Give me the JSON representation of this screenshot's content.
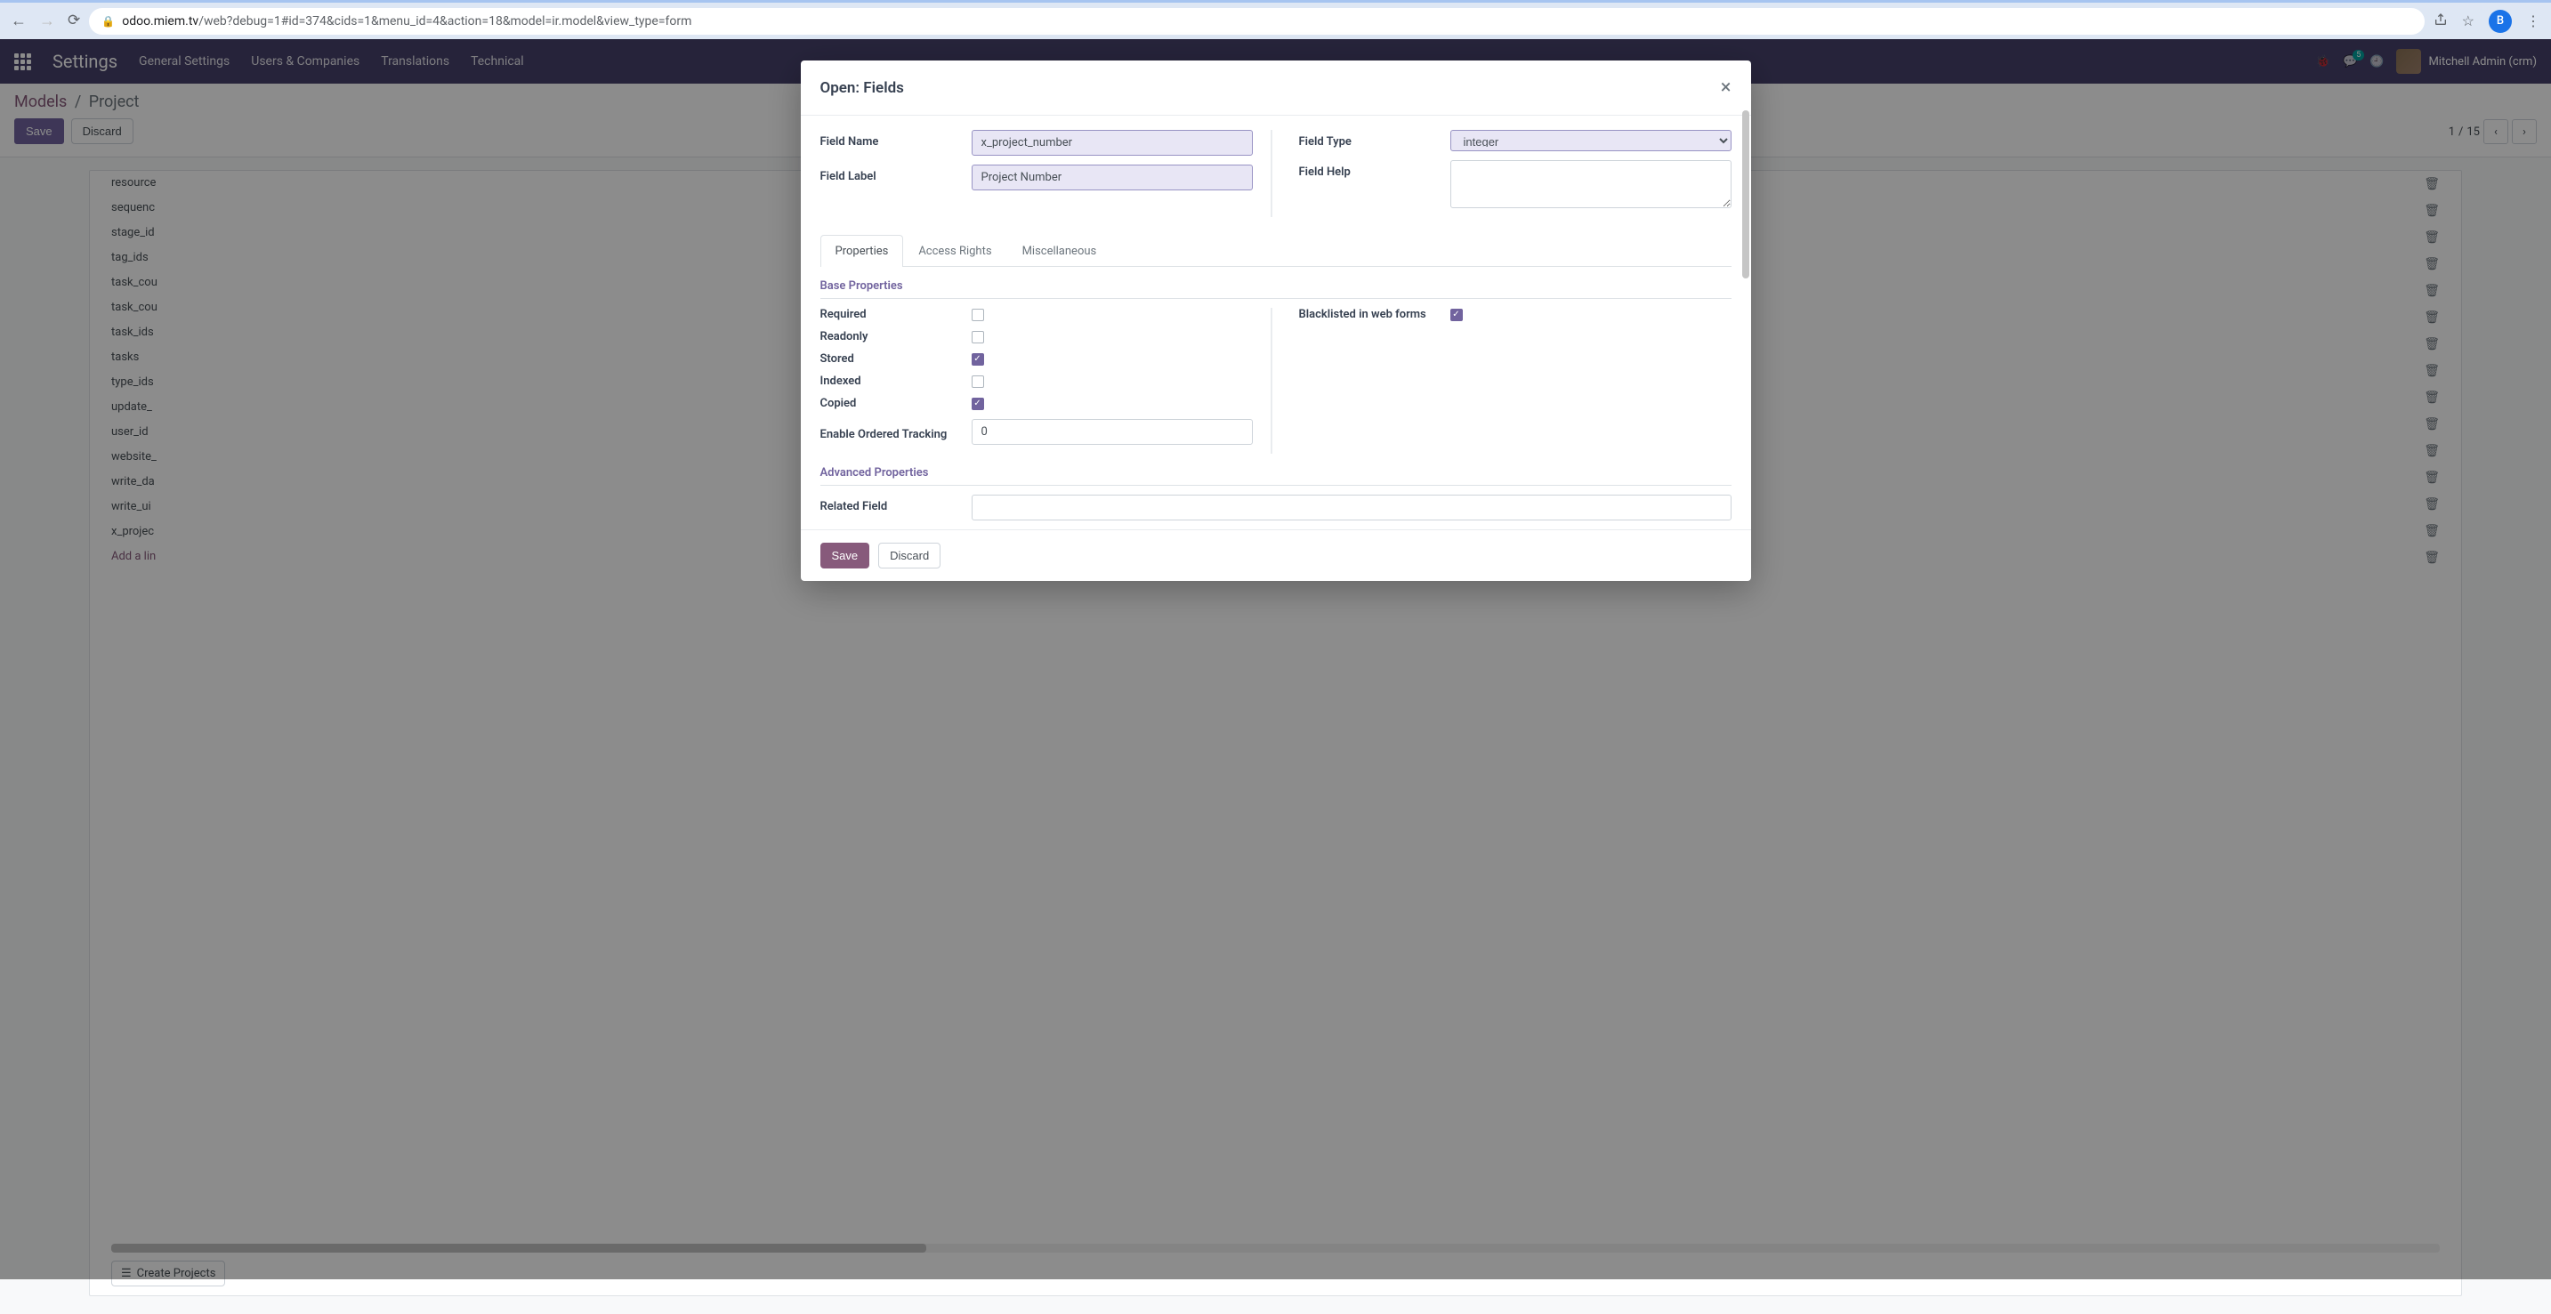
{
  "browser": {
    "url_host": "odoo.miem.tv",
    "url_path": "/web?debug=1#id=374&cids=1&menu_id=4&action=18&model=ir.model&view_type=form",
    "avatar_letter": "B"
  },
  "odoo": {
    "app_title": "Settings",
    "menu": [
      "General Settings",
      "Users & Companies",
      "Translations",
      "Technical"
    ],
    "notif_count": "5",
    "user_name": "Mitchell Admin (crm)"
  },
  "breadcrumb": {
    "root": "Models",
    "sep": "/",
    "current": "Project"
  },
  "buttons": {
    "save": "Save",
    "discard": "Discard",
    "create": "Create Projects"
  },
  "pager": {
    "current": "1",
    "sep": "/",
    "total": "15"
  },
  "bg_fields": [
    "resource",
    "sequenc",
    "stage_id",
    "tag_ids",
    "task_cou",
    "task_cou",
    "task_ids",
    "tasks",
    "type_ids",
    "update_",
    "user_id",
    "website_",
    "write_da",
    "write_ui",
    "x_projec"
  ],
  "bg_add_line": "Add a lin",
  "modal": {
    "title": "Open: Fields",
    "labels": {
      "field_name": "Field Name",
      "field_label": "Field Label",
      "field_type": "Field Type",
      "field_help": "Field Help"
    },
    "values": {
      "field_name": "x_project_number",
      "field_label": "Project Number",
      "field_type": "integer",
      "field_help": ""
    },
    "tabs": [
      "Properties",
      "Access Rights",
      "Miscellaneous"
    ],
    "active_tab": 0,
    "sections": {
      "base": "Base Properties",
      "advanced": "Advanced Properties"
    },
    "props": {
      "required": {
        "label": "Required",
        "checked": false
      },
      "readonly": {
        "label": "Readonly",
        "checked": false
      },
      "stored": {
        "label": "Stored",
        "checked": true
      },
      "indexed": {
        "label": "Indexed",
        "checked": false
      },
      "copied": {
        "label": "Copied",
        "checked": true
      },
      "blacklisted": {
        "label": "Blacklisted in web forms",
        "checked": true
      },
      "enable_ordered": {
        "label": "Enable Ordered Tracking",
        "value": "0"
      },
      "related_field": {
        "label": "Related Field",
        "value": ""
      }
    },
    "footer": {
      "save": "Save",
      "discard": "Discard"
    }
  }
}
